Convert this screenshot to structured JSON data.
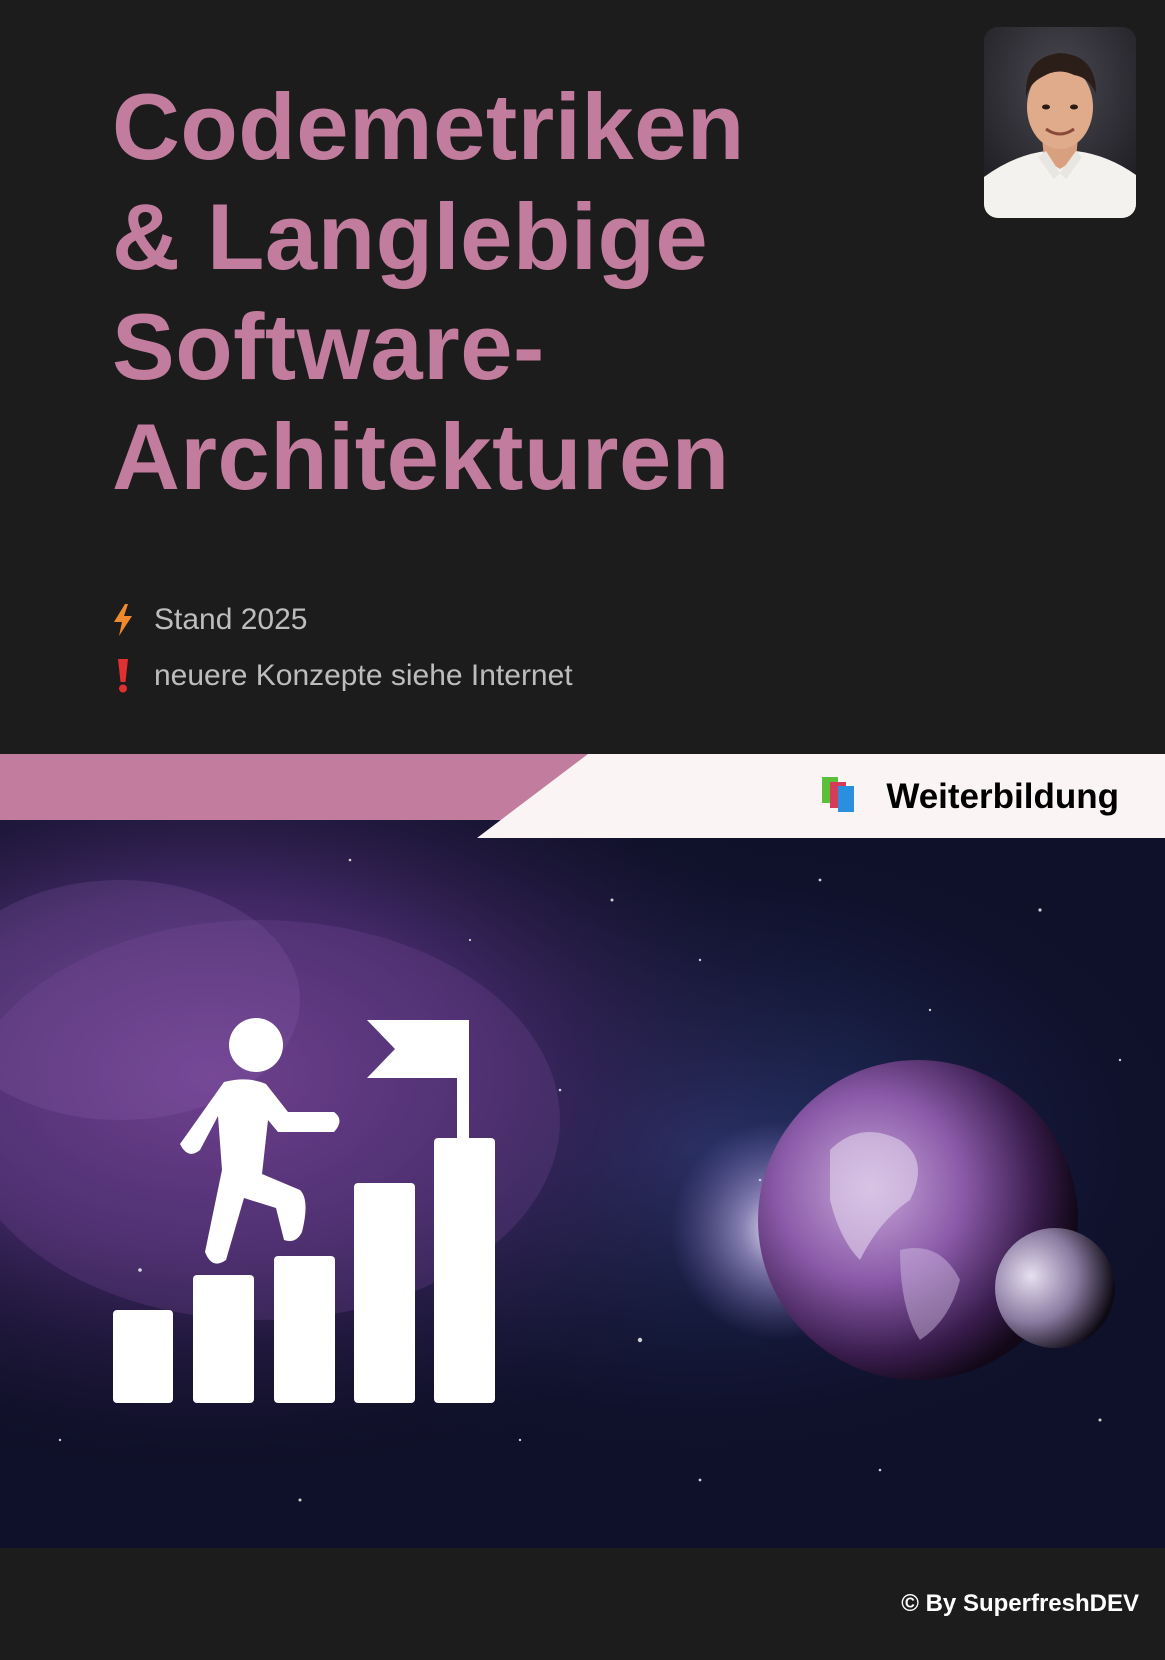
{
  "title_lines": [
    "Codemetriken",
    "& Langlebige",
    "Software-",
    "Architekturen"
  ],
  "notes": [
    {
      "icon": "lightning-icon",
      "text": "Stand 2025"
    },
    {
      "icon": "exclamation-icon",
      "text": "neuere Konzepte siehe Internet"
    }
  ],
  "banner": {
    "icon": "books-icon",
    "label": "Weiterbildung"
  },
  "footer": {
    "text": "© By SuperfreshDEV"
  },
  "colors": {
    "background": "#1c1c1c",
    "accent": "#c27c9e",
    "banner_light": "#fbf4f5",
    "note_text": "#bdbdbd",
    "lightning": "#f08a2c",
    "exclamation": "#e03030"
  },
  "images": {
    "avatar": "portrait-photo",
    "hero": "space-scene-with-planet-and-climbing-person-pictogram"
  }
}
